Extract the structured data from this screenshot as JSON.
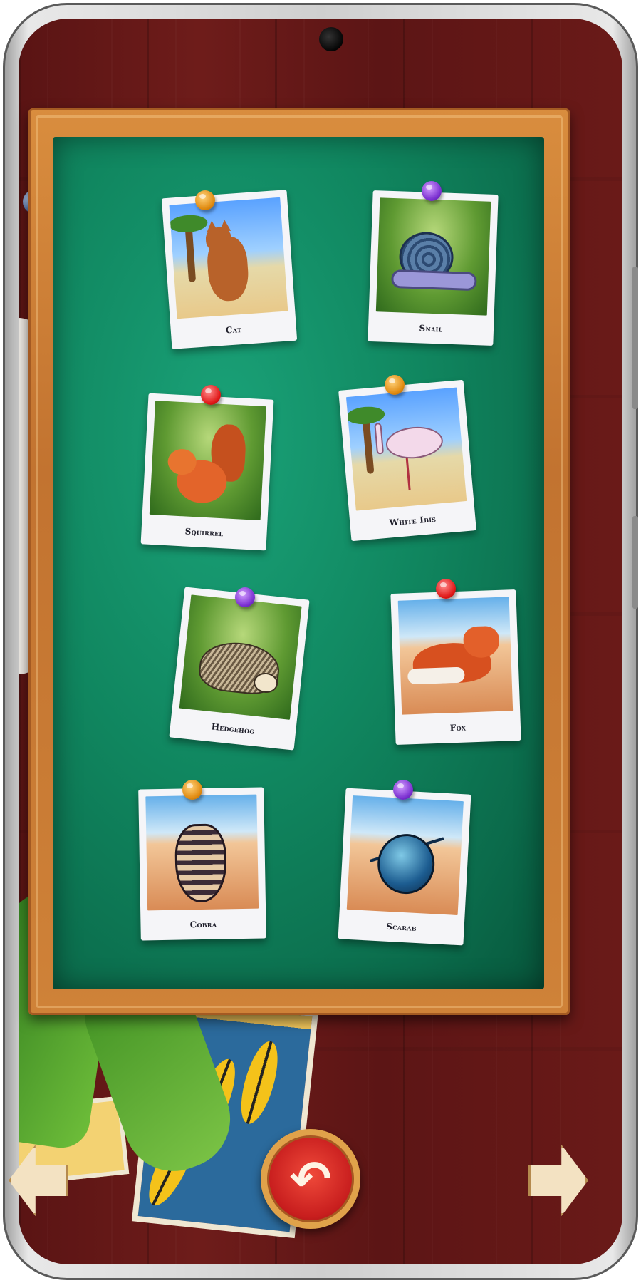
{
  "board": {
    "cards": [
      {
        "name": "Cat",
        "scene": "beach",
        "pin": "orange",
        "animal": "cat"
      },
      {
        "name": "Snail",
        "scene": "forest",
        "pin": "purple",
        "animal": "snail"
      },
      {
        "name": "Squirrel",
        "scene": "forest",
        "pin": "red",
        "animal": "squirrel"
      },
      {
        "name": "White Ibis",
        "scene": "beach",
        "pin": "orange",
        "animal": "ibis"
      },
      {
        "name": "Hedgehog",
        "scene": "forest",
        "pin": "purple",
        "animal": "hedgehog"
      },
      {
        "name": "Fox",
        "scene": "desert",
        "pin": "red",
        "animal": "fox"
      },
      {
        "name": "Cobra",
        "scene": "desert",
        "pin": "orange",
        "animal": "cobra"
      },
      {
        "name": "Scarab",
        "scene": "desert",
        "pin": "purple",
        "animal": "scarab"
      }
    ]
  },
  "controls": {
    "back_icon": "undo-arrow-icon",
    "prev_icon": "arrow-left-icon",
    "next_icon": "arrow-right-icon"
  },
  "colors": {
    "felt": "#10865f",
    "frame": "#c27330",
    "wood": "#5c1515",
    "back_button": "#c81e1e"
  }
}
